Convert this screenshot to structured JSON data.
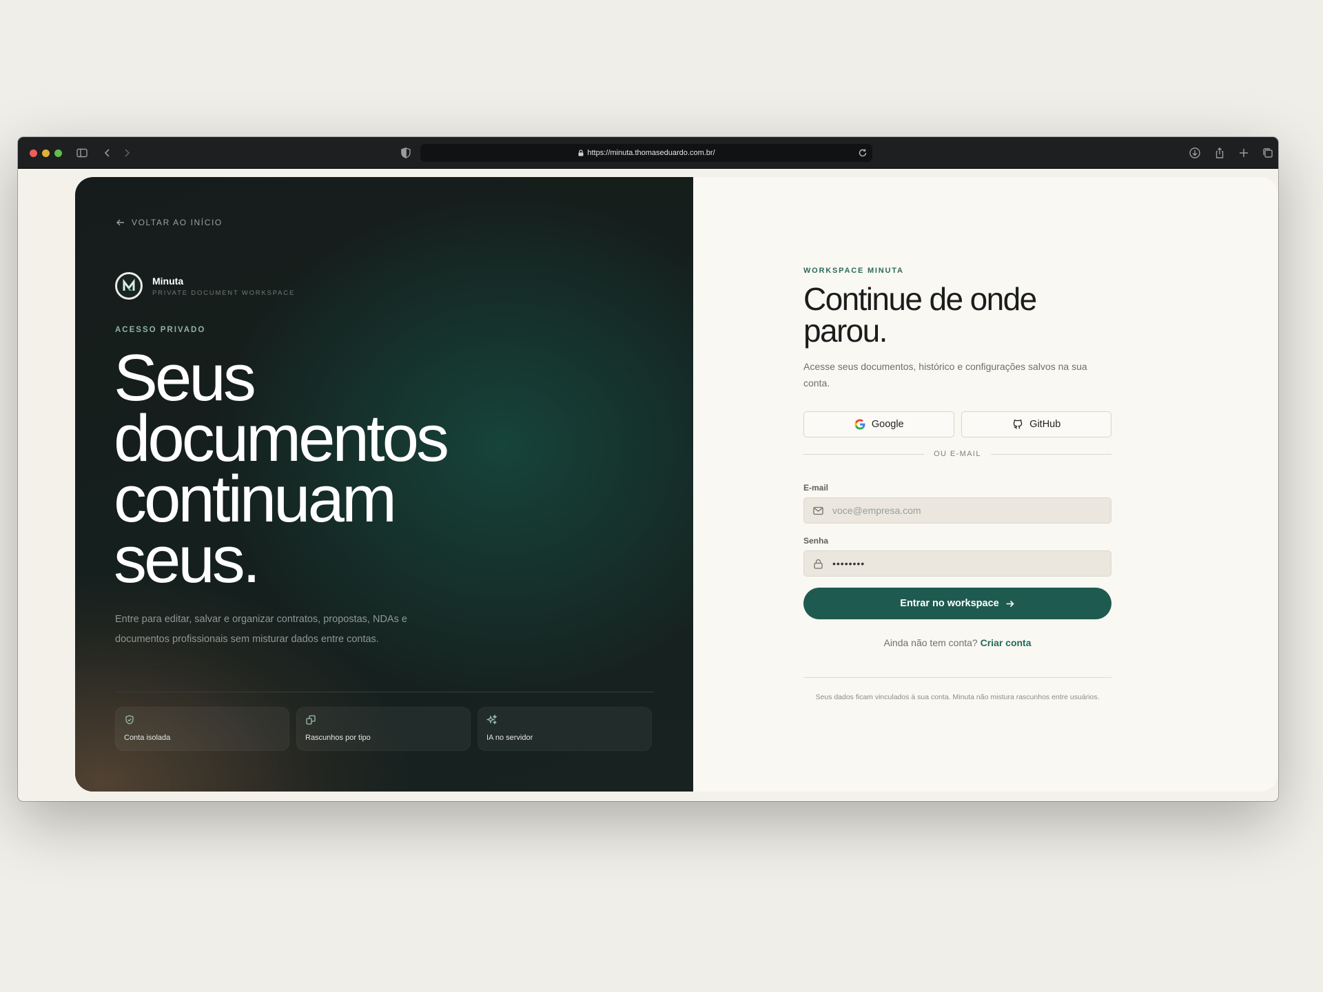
{
  "browser": {
    "url": "https://minuta.thomaseduardo.com.br/"
  },
  "left": {
    "back_link": "VOLTAR AO INÍCIO",
    "brand_name": "Minuta",
    "brand_tagline": "PRIVATE DOCUMENT WORKSPACE",
    "eyebrow": "ACESSO PRIVADO",
    "headline_lines": [
      "Seus",
      "documentos",
      "continuam",
      "seus."
    ],
    "lede": "Entre para editar, salvar e organizar contratos, propostas, NDAs e documentos profissionais sem misturar dados entre contas.",
    "features": [
      {
        "label": "Conta isolada",
        "icon": "shield-check-icon"
      },
      {
        "label": "Rascunhos por tipo",
        "icon": "copy-icon"
      },
      {
        "label": "IA no servidor",
        "icon": "sparkles-icon"
      }
    ]
  },
  "right": {
    "eyebrow": "WORKSPACE MINUTA",
    "title": "Continue de onde parou.",
    "subtitle": "Acesse seus documentos, histórico e configurações salvos na sua conta.",
    "oauth": {
      "google": "Google",
      "github": "GitHub"
    },
    "divider": "OU E-MAIL",
    "email": {
      "label": "E-mail",
      "placeholder": "voce@empresa.com",
      "value": ""
    },
    "password": {
      "label": "Senha",
      "value": "••••••••"
    },
    "submit": "Entrar no workspace",
    "signup_prompt": "Ainda não tem conta?",
    "signup_link": "Criar conta",
    "footnote": "Seus dados ficam vinculados à sua conta. Minuta não mistura rascunhos entre usuários."
  },
  "colors": {
    "accent": "#1f5a50",
    "accent_text": "#2b6a5c",
    "left_panel": "#161c1b",
    "right_panel": "#faf8f2"
  }
}
